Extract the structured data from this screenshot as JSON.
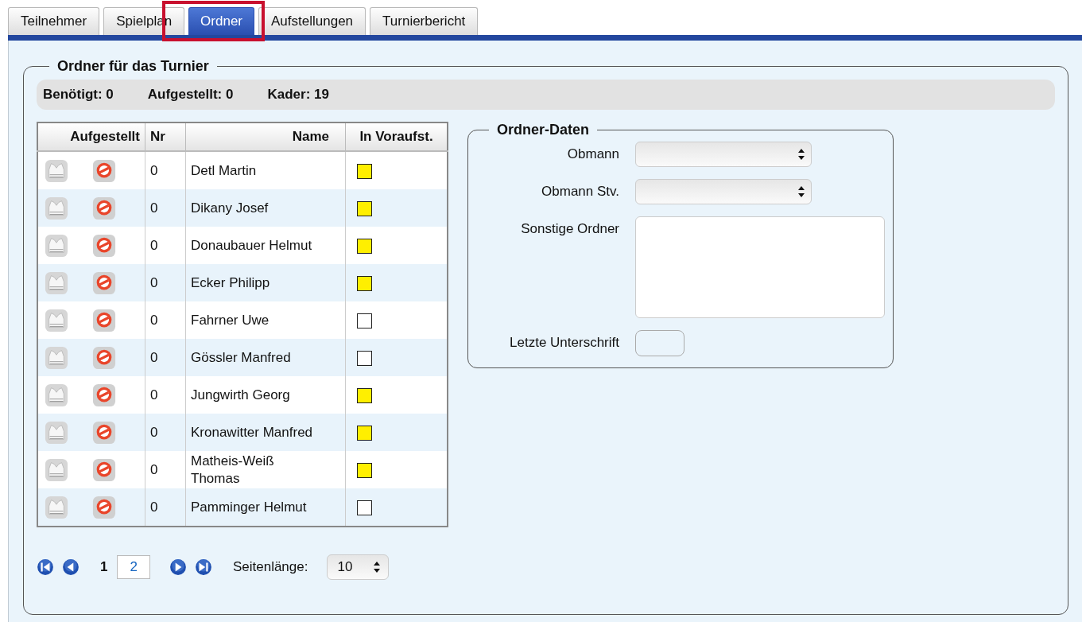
{
  "tabs": [
    {
      "label": "Teilnehmer",
      "selected": false,
      "highlighted": false
    },
    {
      "label": "Spielplan",
      "selected": false,
      "highlighted": false
    },
    {
      "label": "Ordner",
      "selected": true,
      "highlighted": true
    },
    {
      "label": "Aufstellungen",
      "selected": false,
      "highlighted": false
    },
    {
      "label": "Turnierbericht",
      "selected": false,
      "highlighted": false
    }
  ],
  "panel": {
    "title": "Ordner für das Turnier",
    "summary": [
      "Benötigt: 0",
      "Aufgestellt: 0",
      "Kader: 19"
    ],
    "table": {
      "columns": [
        "Aufgestellt",
        "Nr",
        "Name",
        "In Voraufst."
      ],
      "rows": [
        {
          "nr": "0",
          "name": "Detl Martin",
          "checked": true
        },
        {
          "nr": "0",
          "name": "Dikany Josef",
          "checked": true
        },
        {
          "nr": "0",
          "name": "Donaubauer Helmut",
          "checked": true
        },
        {
          "nr": "0",
          "name": "Ecker Philipp",
          "checked": true
        },
        {
          "nr": "0",
          "name": "Fahrner Uwe",
          "checked": false
        },
        {
          "nr": "0",
          "name": "Gössler Manfred",
          "checked": false
        },
        {
          "nr": "0",
          "name": "Jungwirth Georg",
          "checked": true
        },
        {
          "nr": "0",
          "name": "Kronawitter Manfred",
          "checked": true
        },
        {
          "nr": "0",
          "name": "Matheis-Weiß Thomas",
          "checked": true
        },
        {
          "nr": "0",
          "name": "Pamminger Helmut",
          "checked": false
        }
      ]
    },
    "pager": {
      "pages": [
        {
          "label": "1",
          "selected": true
        },
        {
          "label": "2",
          "selected": false
        }
      ],
      "page_length_label": "Seitenlänge:",
      "page_length": "10"
    },
    "details": {
      "title": "Ordner-Daten",
      "fields": [
        {
          "label": "Obmann",
          "kind": "select"
        },
        {
          "label": "Obmann Stv.",
          "kind": "select"
        },
        {
          "label": "Sonstige Ordner",
          "kind": "textarea"
        },
        {
          "label": "Letzte Unterschrift",
          "kind": "input"
        }
      ]
    }
  }
}
